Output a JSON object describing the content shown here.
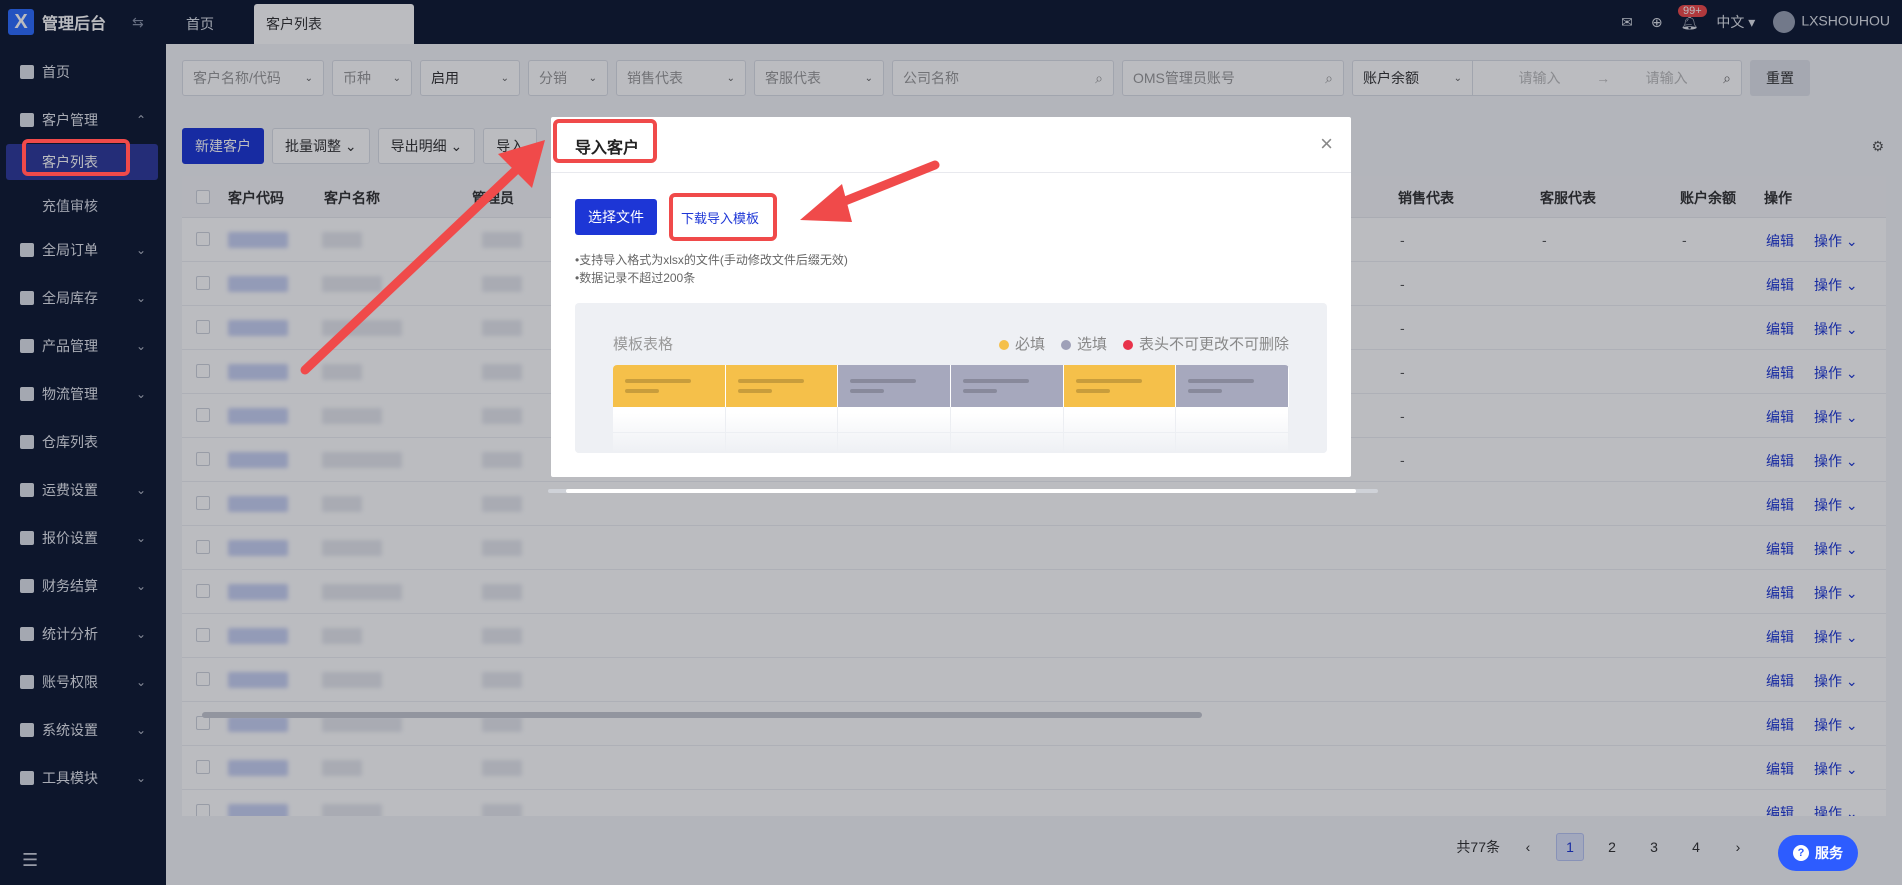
{
  "app": {
    "title": "管理后台",
    "logo_letter": "X",
    "collapse_glyph": "⇆"
  },
  "sidebar": {
    "items": [
      {
        "label": "首页",
        "icon": "home-icon",
        "chevron": ""
      },
      {
        "label": "客户管理",
        "icon": "users-icon",
        "chevron": "⌃"
      },
      {
        "label": "全局订单",
        "icon": "orders-icon",
        "chevron": "⌄"
      },
      {
        "label": "全局库存",
        "icon": "inventory-icon",
        "chevron": "⌄"
      },
      {
        "label": "产品管理",
        "icon": "product-icon",
        "chevron": "⌄"
      },
      {
        "label": "物流管理",
        "icon": "truck-icon",
        "chevron": "⌄"
      },
      {
        "label": "仓库列表",
        "icon": "warehouse-icon",
        "chevron": ""
      },
      {
        "label": "运费设置",
        "icon": "freight-icon",
        "chevron": "⌄"
      },
      {
        "label": "报价设置",
        "icon": "quote-icon",
        "chevron": "⌄"
      },
      {
        "label": "财务结算",
        "icon": "finance-icon",
        "chevron": "⌄"
      },
      {
        "label": "统计分析",
        "icon": "chart-icon",
        "chevron": "⌄"
      },
      {
        "label": "账号权限",
        "icon": "org-icon",
        "chevron": "⌄"
      },
      {
        "label": "系统设置",
        "icon": "settings-icon",
        "chevron": "⌄"
      },
      {
        "label": "工具模块",
        "icon": "tool-icon",
        "chevron": "⌄"
      }
    ],
    "sub_items": [
      {
        "label": "客户列表",
        "active": true
      },
      {
        "label": "充值审核",
        "active": false
      }
    ],
    "footer_icon": "☰"
  },
  "topbar": {
    "tabs": [
      {
        "label": "首页"
      },
      {
        "label": "客户列表"
      }
    ],
    "notifications_badge": "99+",
    "language": "中文",
    "user": "LXSHOUHOU"
  },
  "filters": {
    "customer": "客户名称/代码",
    "currency": "币种",
    "status": "启用",
    "distribution": "分销",
    "sales": "销售代表",
    "service": "客服代表",
    "company_placeholder": "公司名称",
    "oms_placeholder": "OMS管理员账号",
    "balance_type": "账户余额",
    "range_from_placeholder": "请输入",
    "range_to_placeholder": "请输入",
    "range_arrow": "→",
    "reset": "重置"
  },
  "toolbar": {
    "new_customer": "新建客户",
    "batch_adjust": "批量调整",
    "export_details": "导出明细",
    "import": "导入"
  },
  "table": {
    "headers": {
      "code": "客户代码",
      "name": "客户名称",
      "admin": "管理员",
      "sales": "销售代表",
      "service": "客服代表",
      "balance": "账户余额",
      "action": "操作"
    },
    "edit_label": "编辑",
    "ops_label": "操作 ⌄",
    "dash": "-"
  },
  "pagination": {
    "total": "共77条",
    "pages": [
      "1",
      "2",
      "3",
      "4"
    ],
    "current": "1",
    "prev": "‹",
    "next": "›"
  },
  "service_button": {
    "label": "服务",
    "icon": "?"
  },
  "modal": {
    "title": "导入客户",
    "close": "×",
    "choose_file": "选择文件",
    "download_template": "下载导入模板",
    "hints": [
      "•支持导入格式为xlsx的文件(手动修改文件后缀无效)",
      "•数据记录不超过200条"
    ],
    "template": {
      "title": "模板表格",
      "legend": [
        {
          "label": "必填",
          "color": "#f5c04a"
        },
        {
          "label": "选填",
          "color": "#9ea0b8"
        },
        {
          "label": "表头不可更改不可删除",
          "color": "#e8334a"
        }
      ],
      "columns": [
        "required",
        "required",
        "optional",
        "optional",
        "required",
        "optional"
      ]
    }
  },
  "colors": {
    "primary": "#1d36d6",
    "sidebar_bg": "#0f1a33",
    "highlight": "#f04a4a",
    "required": "#f5c04a",
    "optional": "#a6a8bd"
  }
}
